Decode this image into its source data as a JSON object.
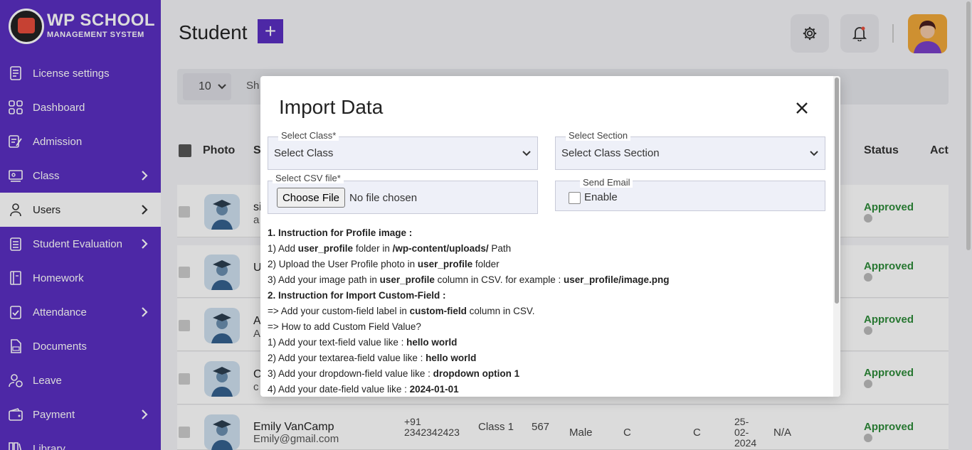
{
  "app": {
    "logo_line1": "WP SCHOOL",
    "logo_line2": "MANAGEMENT SYSTEM"
  },
  "sidebar": {
    "items": [
      {
        "label": "License settings",
        "icon": "license-icon"
      },
      {
        "label": "Dashboard",
        "icon": "dashboard-icon"
      },
      {
        "label": "Admission",
        "icon": "admission-icon"
      },
      {
        "label": "Class",
        "icon": "class-icon",
        "chevron": true
      },
      {
        "label": "Users",
        "icon": "user-icon",
        "chevron": true,
        "active": true
      },
      {
        "label": "Student Evaluation",
        "icon": "evaluation-icon",
        "chevron": true
      },
      {
        "label": "Homework",
        "icon": "homework-icon"
      },
      {
        "label": "Attendance",
        "icon": "attendance-icon",
        "chevron": true
      },
      {
        "label": "Documents",
        "icon": "documents-icon"
      },
      {
        "label": "Leave",
        "icon": "leave-icon"
      },
      {
        "label": "Payment",
        "icon": "payment-icon",
        "chevron": true
      },
      {
        "label": "Library",
        "icon": "library-icon"
      }
    ]
  },
  "header": {
    "title": "Student",
    "add_symbol": "+"
  },
  "filters": {
    "page_length": "10",
    "search_label_partial": "Sh"
  },
  "table": {
    "headers": {
      "photo": "Photo",
      "name_partial": "S",
      "status": "Status",
      "action_partial": "Act"
    },
    "rows": [
      {
        "name_partial": "si",
        "email_partial": "a",
        "status": "Approved"
      },
      {
        "name_partial": "U",
        "email_partial": "",
        "status": "Approved"
      },
      {
        "name_partial": "A",
        "email_partial": "A",
        "status": "Approved"
      },
      {
        "name_partial": "C",
        "email_partial": "c",
        "status": "Approved"
      },
      {
        "name": "Emily VanCamp",
        "email": "Emily@gmail.com",
        "phone_code": "+91",
        "phone": "2342342423",
        "class": "Class 1",
        "roll": "567",
        "gender": "Male",
        "section": "C",
        "section2": "C",
        "date_line1": "25-",
        "date_line2": "02-",
        "date_line3": "2024",
        "extra": "N/A",
        "status": "Approved"
      }
    ]
  },
  "modal": {
    "title": "Import Data",
    "select_class": {
      "label": "Select Class*",
      "value": "Select Class"
    },
    "select_section": {
      "label": "Select Section",
      "value": "Select Class Section"
    },
    "csv_file": {
      "label": "Select CSV file*",
      "button": "Choose File",
      "status": "No file chosen"
    },
    "send_email": {
      "label": "Send Email",
      "option": "Enable",
      "checked": false
    },
    "instructions": {
      "h1": "1. Instruction for Profile image :",
      "l1": {
        "a": "1) Add ",
        "b": "user_profile",
        "c": " folder in ",
        "d": "/wp-content/uploads/",
        "e": " Path"
      },
      "l2": {
        "a": "2) Upload the User Profile photo in ",
        "b": "user_profile",
        "c": " folder"
      },
      "l3": {
        "a": "3) Add your image path in ",
        "b": "user_profile",
        "c": " column in CSV. for example : ",
        "d": "user_profile/image.png"
      },
      "h2": "2. Instruction for Import Custom-Field :",
      "l4": {
        "a": "=> Add your custom-field label in ",
        "b": "custom-field",
        "c": " column in CSV."
      },
      "l5": "=> How to add Custom Field Value?",
      "l6": {
        "a": "1) Add your text-field value like : ",
        "b": "hello world"
      },
      "l7": {
        "a": "2) Add your textarea-field value like : ",
        "b": "hello world"
      },
      "l8": {
        "a": "3) Add your dropdown-field value like : ",
        "b": "dropdown option 1"
      },
      "l9": {
        "a": "4) Add your date-field value like : ",
        "b": "2024-01-01"
      }
    }
  },
  "colors": {
    "sidebar": "#5a2fc2",
    "accent": "#5a2fc2",
    "approved": "#2e8b3a"
  }
}
